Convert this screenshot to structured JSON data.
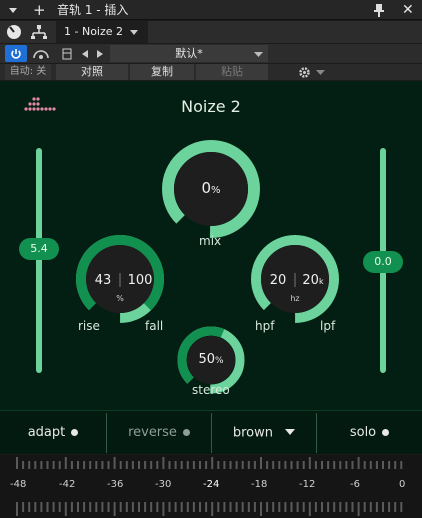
{
  "window": {
    "title": "音轨 1 - 插入",
    "track_label": "1 - Noize 2"
  },
  "toolbar": {
    "preset_name": "默认*",
    "auto_label": "自动: 关",
    "compare_label": "对照",
    "copy_label": "复制",
    "paste_label": "粘贴"
  },
  "plugin": {
    "name": "Noize 2",
    "left_slider_value": "5.4",
    "right_slider_value": "0.0",
    "mix": {
      "value": "0",
      "unit": "%",
      "label": "mix",
      "level": 0.9
    },
    "rise_fall": {
      "rise": "43",
      "fall": "100",
      "unit": "%",
      "rise_label": "rise",
      "fall_label": "fall"
    },
    "hpf_lpf": {
      "hpf": "20",
      "lpf": "20",
      "lpf_suffix": "k",
      "unit": "hz",
      "hpf_label": "hpf",
      "lpf_label": "lpf"
    },
    "stereo": {
      "value": "50",
      "unit": "%",
      "label": "stereo",
      "level": 0.5
    }
  },
  "options": {
    "adapt": "adapt",
    "reverse": "reverse",
    "noise_type": "brown",
    "solo": "solo"
  },
  "meter_scale": [
    "-48",
    "-42",
    "-36",
    "-30",
    "-24",
    "-18",
    "-12",
    "-6",
    "0"
  ],
  "colors": {
    "bg": "#031e12",
    "accent": "#12904f",
    "accent_light": "#6bd39b"
  }
}
